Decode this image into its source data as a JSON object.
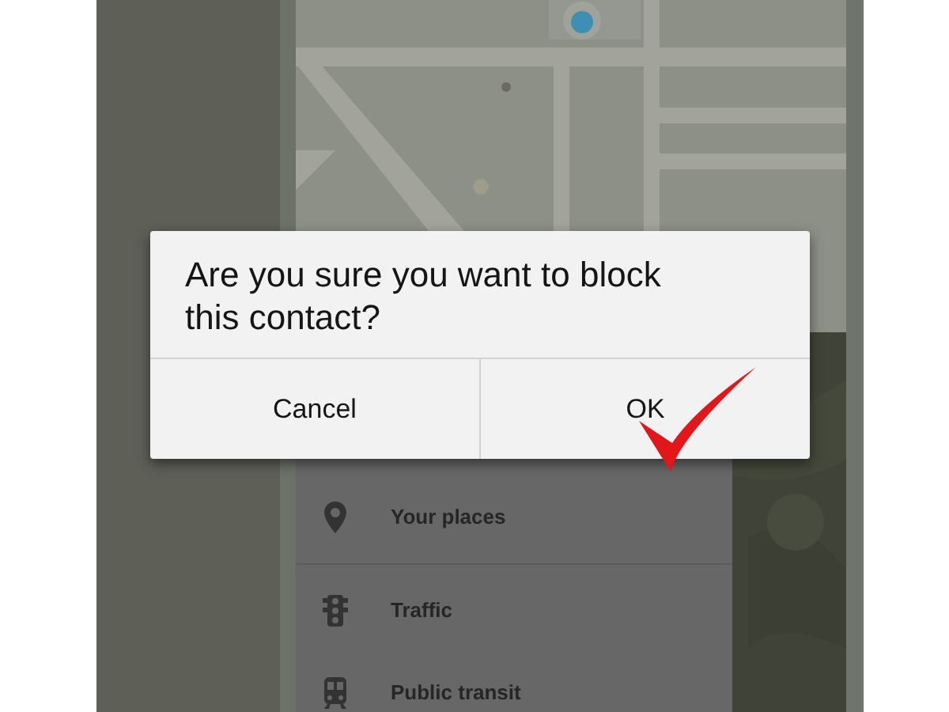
{
  "dialog": {
    "message": "Are you sure you want to block this contact?",
    "buttons": [
      {
        "label": "Cancel"
      },
      {
        "label": "OK"
      }
    ]
  },
  "drawer": {
    "items": [
      {
        "label": "Your places",
        "kind": "pin"
      },
      {
        "label": "Traffic",
        "kind": "traffic"
      },
      {
        "label": "Public transit",
        "kind": "transit"
      }
    ]
  }
}
